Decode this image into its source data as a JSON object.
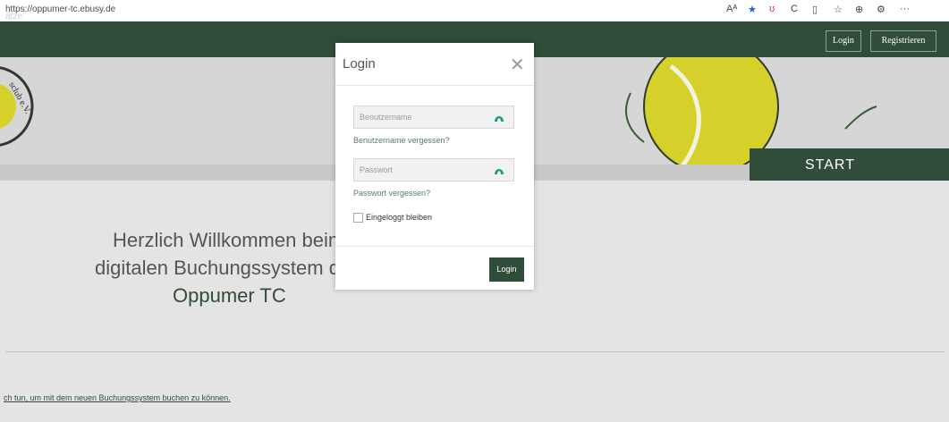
{
  "browser": {
    "url": "https://oppumer-tc.ebusy.de",
    "toolbar_icons": [
      "read-aloud-icon",
      "favorite-star-icon",
      "pocket-icon",
      "refresh-icon",
      "split-screen-icon",
      "favorites-icon",
      "collections-icon",
      "extensions-icon",
      "more-icon"
    ],
    "toolbar_glyphs": {
      "read": "Aᴬ",
      "star": "★",
      "pocket": "ʊ",
      "refresh": "C",
      "split": "▯",
      "fav": "☆",
      "coll": "⊕",
      "ext": "⚙",
      "more": "···"
    }
  },
  "nav": {
    "left_text": "ätze",
    "login_label": "Login",
    "register_label": "Registrieren"
  },
  "hero": {
    "start_label": "START"
  },
  "content": {
    "welcome_line1": "Herzlich Willkommen beim",
    "welcome_line2": "digitalen Buchungssystem de",
    "welcome_line3": "Oppumer TC",
    "footer_link": "ch tun, um mit dem neuen Buchungssystem buchen zu können."
  },
  "modal": {
    "title": "Login",
    "close_glyph": "✕",
    "username_placeholder": "Benutzername",
    "forgot_username": "Benutzername vergessen?",
    "password_placeholder": "Passwort",
    "forgot_password": "Passwort vergessen?",
    "remember_label": "Eingeloggt bleiben",
    "login_button": "Login"
  },
  "colors": {
    "brand_green": "#2f4d38",
    "ball_yellow": "#d6d12a"
  }
}
